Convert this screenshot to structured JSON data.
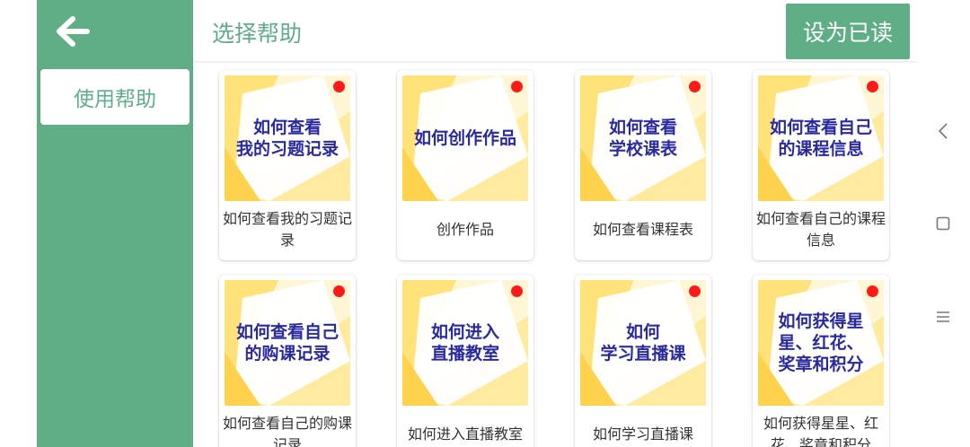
{
  "sidebar": {
    "back_icon": "arrow-left-icon",
    "items": [
      {
        "label": "使用帮助",
        "selected": true
      }
    ]
  },
  "header": {
    "title": "选择帮助",
    "mark_read_label": "设为已读"
  },
  "cards": [
    {
      "thumb_text": "如何查看\n我的习题记录",
      "caption": "如何查看我的习题记录",
      "unread": true
    },
    {
      "thumb_text": "如何创作作品",
      "caption": "创作作品",
      "unread": true
    },
    {
      "thumb_text": "如何查看\n学校课表",
      "caption": "如何查看课程表",
      "unread": true
    },
    {
      "thumb_text": "如何查看自己\n的课程信息",
      "caption": "如何查看自己的课程信息",
      "unread": true
    },
    {
      "thumb_text": "如何查看自己\n的购课记录",
      "caption": "如何查看自己的购课记录",
      "unread": true
    },
    {
      "thumb_text": "如何进入\n直播教室",
      "caption": "如何进入直播教室",
      "unread": true
    },
    {
      "thumb_text": "如何\n学习直播课",
      "caption": "如何学习直播课",
      "unread": true
    },
    {
      "thumb_text": "如何获得星\n星、红花、\n奖章和积分",
      "caption": "如何获得星星、红花、奖章和积分",
      "unread": true
    }
  ],
  "nav_bar": {
    "icons": [
      "back-triangle-icon",
      "home-square-icon",
      "menu-lines-icon"
    ]
  },
  "colors": {
    "accent": "#5fae86",
    "thumb_text": "#2a2aa0",
    "unread_dot": "#ff1a1a",
    "thumb_yellow": "#ffe27a"
  }
}
